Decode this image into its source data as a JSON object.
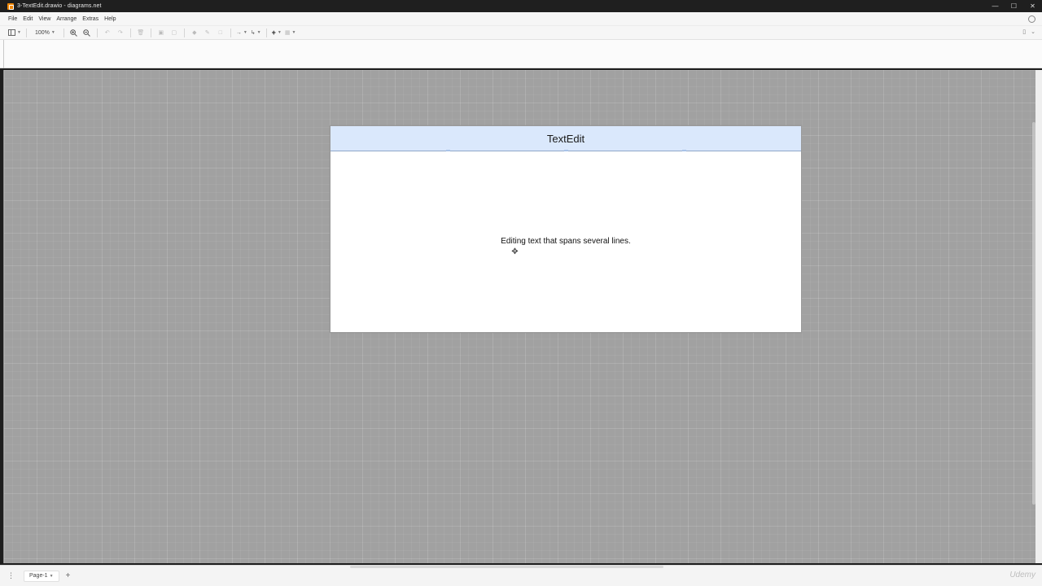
{
  "window": {
    "title": "3-TextEdit.drawio - diagrams.net",
    "controls": [
      "—",
      "☐",
      "✕"
    ]
  },
  "menu": {
    "items": [
      "File",
      "Edit",
      "View",
      "Arrange",
      "Extras",
      "Help"
    ]
  },
  "toolbar": {
    "zoom": "100%"
  },
  "diagram": {
    "header": "TextEdit",
    "body_text": "Editing text that spans several lines.",
    "colors": {
      "header_fill": "#dae8fc",
      "body_fill": "#ffffff",
      "canvas": "#a1a1a1"
    }
  },
  "footer": {
    "page_tab": "Page-1",
    "watermark": "Udemy"
  }
}
